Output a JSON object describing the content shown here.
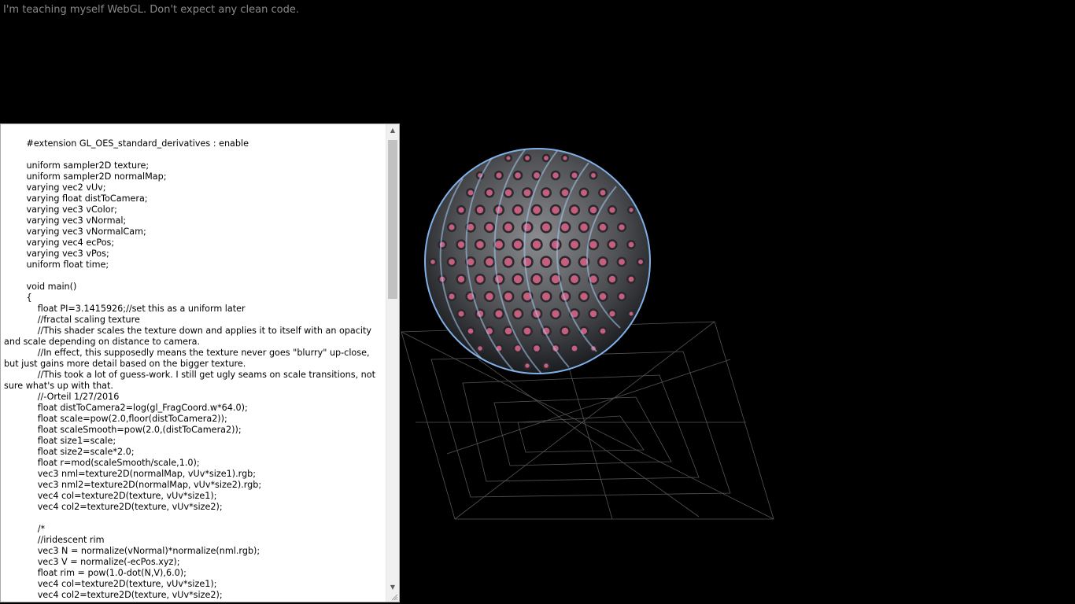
{
  "header": {
    "note": "I'm teaching myself WebGL. Don't expect any clean code."
  },
  "editor": {
    "lines": [
      "\t\t#extension GL_OES_standard_derivatives : enable",
      "",
      "\t\tuniform sampler2D texture;",
      "\t\tuniform sampler2D normalMap;",
      "\t\tvarying vec2 vUv;",
      "\t\tvarying float distToCamera;",
      "\t\tvarying vec3 vColor;",
      "\t\tvarying vec3 vNormal;",
      "\t\tvarying vec3 vNormalCam;",
      "\t\tvarying vec4 ecPos;",
      "\t\tvarying vec3 vPos;",
      "\t\tuniform float time;",
      "",
      "\t\tvoid main()",
      "\t\t{",
      "\t\t\tfloat PI=3.1415926;//set this as a uniform later",
      "\t\t\t//fractal scaling texture",
      "\t\t\t//This shader scales the texture down and applies it to itself with an opacity and scale depending on distance to camera.",
      "\t\t\t//In effect, this supposedly means the texture never goes \"blurry\" up-close, but just gains more detail based on the bigger texture.",
      "\t\t\t//This took a lot of guess-work. I still get ugly seams on scale transitions, not sure what's up with that.",
      "\t\t\t//-Orteil 1/27/2016",
      "\t\t\tfloat distToCamera2=log(gl_FragCoord.w*64.0);",
      "\t\t\tfloat scale=pow(2.0,floor(distToCamera2));",
      "\t\t\tfloat scaleSmooth=pow(2.0,(distToCamera2));",
      "\t\t\tfloat size1=scale;",
      "\t\t\tfloat size2=scale*2.0;",
      "\t\t\tfloat r=mod(scaleSmooth/scale,1.0);",
      "\t\t\tvec3 nml=texture2D(normalMap, vUv*size1).rgb;",
      "\t\t\tvec3 nml2=texture2D(normalMap, vUv*size2).rgb;",
      "\t\t\tvec4 col=texture2D(texture, vUv*size1);",
      "\t\t\tvec4 col2=texture2D(texture, vUv*size2);",
      "",
      "\t\t\t/*",
      "\t\t\t//iridescent rim",
      "\t\t\tvec3 N = normalize(vNormal)*normalize(nml.rgb);",
      "\t\t\tvec3 V = normalize(-ecPos.xyz);",
      "\t\t\tfloat rim = pow(1.0-dot(N,V),6.0);",
      "\t\t\tvec4 col=texture2D(texture, vUv*size1);",
      "\t\t\tvec4 col2=texture2D(texture, vUv*size2);"
    ]
  },
  "scene": {
    "object": "ridged sphere with rivet texture",
    "colors": {
      "base": "#6e6f72",
      "rivet": "#c65e7e",
      "rim": "#9ec8ff",
      "wireframe": "#9a9a9a"
    }
  }
}
